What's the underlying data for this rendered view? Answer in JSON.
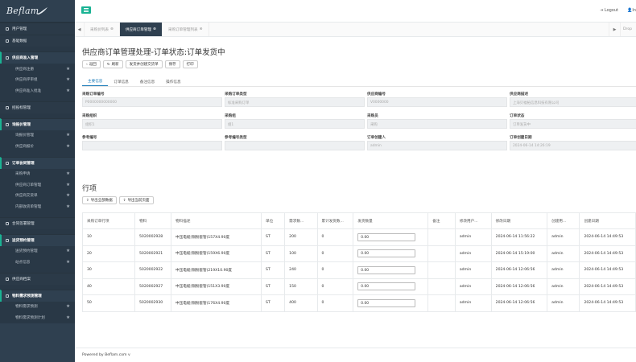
{
  "brand": {
    "logo": "Beflam"
  },
  "sidebar": [
    {
      "type": "group",
      "label": "用户管理",
      "active": false
    },
    {
      "type": "group",
      "label": "基础数据",
      "active": false
    },
    {
      "type": "spacer"
    },
    {
      "type": "group",
      "label": "供应商准入管理",
      "active": true
    },
    {
      "type": "item",
      "label": "供应商注册"
    },
    {
      "type": "item",
      "label": "供应商评审组"
    },
    {
      "type": "item",
      "label": "供应商准入批准"
    },
    {
      "type": "spacer"
    },
    {
      "type": "group",
      "label": "招投标管理",
      "active": false
    },
    {
      "type": "spacer"
    },
    {
      "type": "group",
      "label": "询报价管理",
      "active": true
    },
    {
      "type": "item",
      "label": "询报价管理"
    },
    {
      "type": "item",
      "label": "供应商报价"
    },
    {
      "type": "spacer"
    },
    {
      "type": "group",
      "label": "订单协同管理",
      "active": true
    },
    {
      "type": "item",
      "label": "采购申请"
    },
    {
      "type": "item",
      "label": "供应商订单管理"
    },
    {
      "type": "item",
      "label": "供应商交货单"
    },
    {
      "type": "item",
      "label": "内部收货单管理"
    },
    {
      "type": "spacer"
    },
    {
      "type": "group",
      "label": "合同签署管理",
      "active": false
    },
    {
      "type": "spacer"
    },
    {
      "type": "group",
      "label": "送货预约管理",
      "active": true
    },
    {
      "type": "item",
      "label": "送货预约管理"
    },
    {
      "type": "item",
      "label": "站点信息"
    },
    {
      "type": "spacer"
    },
    {
      "type": "group",
      "label": "供应商档案",
      "active": false
    },
    {
      "type": "spacer"
    },
    {
      "type": "group",
      "label": "物料需求预测管理",
      "active": true
    },
    {
      "type": "item",
      "label": "物料需求预测"
    },
    {
      "type": "item",
      "label": "物料需求预测计划"
    }
  ],
  "topbar": {
    "logout": "Logout",
    "user": "In"
  },
  "tabs": [
    {
      "label": "采购价列表",
      "active": false
    },
    {
      "label": "供应商订单管理",
      "active": true
    },
    {
      "label": "采购订单管理列表",
      "active": false
    }
  ],
  "tabs_extra": {
    "drop": "Drop"
  },
  "page": {
    "title": "供应商订单管理处理-订单状态:订单发货中"
  },
  "toolbar": [
    "返回",
    "刷新",
    "发货并创建交货单",
    "保存",
    "打印"
  ],
  "subtabs": [
    "主要信息",
    "订单信息",
    "备注信息",
    "操作信息"
  ],
  "form": [
    [
      {
        "label": "采购订单编号",
        "value": "P0000000000000"
      },
      {
        "label": "采购订单类型",
        "value": "标准采购订单"
      },
      {
        "label": "供应商编号",
        "value": "V0000000"
      },
      {
        "label": "供应商描述",
        "value": "上海贝福拓信息科技有限公司"
      }
    ],
    [
      {
        "label": "采购组织",
        "value": "组织1"
      },
      {
        "label": "采购组",
        "value": "组1"
      },
      {
        "label": "采购员",
        "value": "采购"
      },
      {
        "label": "订单状态",
        "value": "订单发货中"
      }
    ],
    [
      {
        "label": "参考编号",
        "value": ""
      },
      {
        "label": "参考编号类型",
        "value": ""
      },
      {
        "label": "订单创建人",
        "value": "admin"
      },
      {
        "label": "订单创建日期",
        "value": "2024-06-14 14:26:19"
      }
    ]
  ],
  "section": {
    "title": "行项"
  },
  "table_buttons": [
    "导出全部数据",
    "导出当前页面"
  ],
  "table": {
    "headers": [
      "采购订单行项",
      "物料",
      "物料描述",
      "单位",
      "需求数...",
      "累计发货数...",
      "发货数量",
      "备注",
      "修改用户...",
      "修改日期",
      "创建用...",
      "创建日期"
    ],
    "rows": [
      [
        "10",
        "5020002928",
        "中压电缆(铜粉套管)157X4.90度",
        "ST",
        "200",
        "0",
        "0.00",
        "",
        "admin",
        "2024-06-14 11:56:22",
        "admin",
        "2024-06-14 14:49:53"
      ],
      [
        "20",
        "5020002921",
        "中压电缆(铜粉套管)159X6.90度",
        "ST",
        "100",
        "0",
        "0.00",
        "",
        "admin",
        "2024-06-14 15:19:00",
        "admin",
        "2024-06-14 14:49:53"
      ],
      [
        "30",
        "5020002922",
        "中压电缆(铜粉套管)219X10.90度",
        "ST",
        "240",
        "0",
        "0.00",
        "",
        "admin",
        "2024-06-14 12:06:56",
        "admin",
        "2024-06-14 14:49:53"
      ],
      [
        "40",
        "5020002927",
        "中压电缆(铜粉套管)151X3.90度",
        "ST",
        "150",
        "0",
        "0.00",
        "",
        "admin",
        "2024-06-14 12:06:56",
        "admin",
        "2024-06-14 14:49:53"
      ],
      [
        "50",
        "5020002930",
        "中压电缆(铜粉套管)176X4.90度",
        "ST",
        "400",
        "0",
        "0.00",
        "",
        "admin",
        "2024-06-14 12:06:56",
        "admin",
        "2024-06-14 14:49:53"
      ]
    ]
  },
  "footer": "Powered by Beflam.com v"
}
